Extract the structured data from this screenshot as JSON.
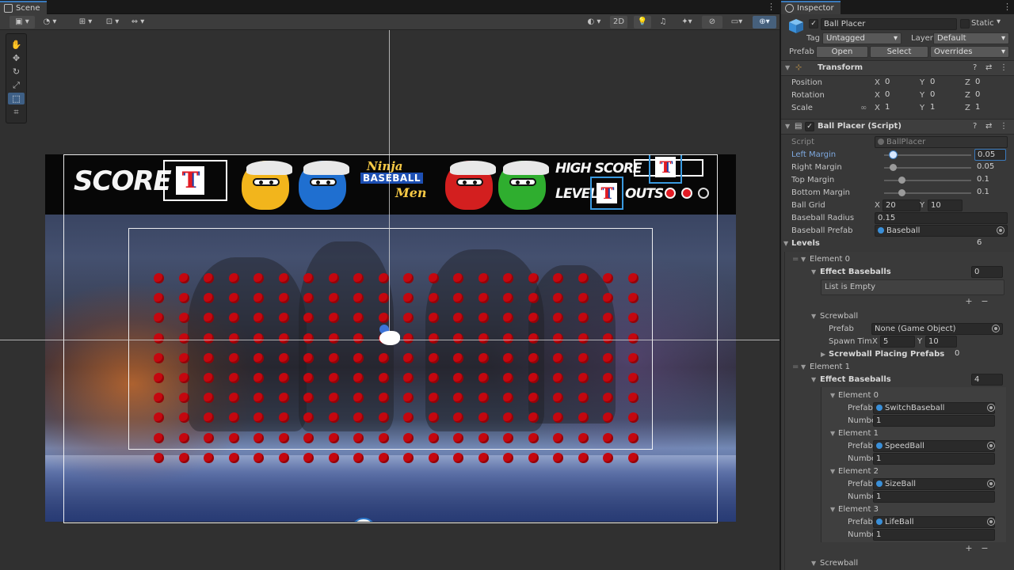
{
  "scene": {
    "tab_label": "Scene",
    "toolbar": {
      "two_d_label": "2D"
    }
  },
  "game": {
    "hud": {
      "score_label": "SCORE",
      "t_letter": "T",
      "high_score_label": "HIGH SCORE",
      "level_label": "LEVEL",
      "outs_label": "OUTS",
      "logo": {
        "line1": "Ninja",
        "line2": "BASEBALL",
        "line3": "Men"
      },
      "outs": [
        true,
        true,
        false
      ],
      "ninja_colors": [
        "#f2b51c",
        "#1f6fd0",
        "#d31f1f",
        "#2fae2f"
      ]
    },
    "ball_grid": {
      "columns": 20,
      "rows": 10,
      "ball_color": "#c4070f"
    }
  },
  "inspector": {
    "tab_label": "Inspector",
    "object_name": "Ball Placer",
    "static_label": "Static",
    "tag_label": "Tag",
    "tag_value": "Untagged",
    "layer_label": "Layer",
    "layer_value": "Default",
    "prefab_label": "Prefab",
    "prefab_open": "Open",
    "prefab_select": "Select",
    "prefab_overrides": "Overrides",
    "transform": {
      "title": "Transform",
      "position_label": "Position",
      "rotation_label": "Rotation",
      "scale_label": "Scale",
      "position": {
        "x": "0",
        "y": "0",
        "z": "0"
      },
      "rotation": {
        "x": "0",
        "y": "0",
        "z": "0"
      },
      "scale": {
        "x": "1",
        "y": "1",
        "z": "1"
      },
      "axis_x": "X",
      "axis_y": "Y",
      "axis_z": "Z"
    },
    "script_component": {
      "title": "Ball Placer (Script)",
      "script_label": "Script",
      "script_value": "BallPlacer",
      "left_margin_label": "Left Margin",
      "left_margin": "0.05",
      "left_margin_frac": 0.05,
      "right_margin_label": "Right Margin",
      "right_margin": "0.05",
      "right_margin_frac": 0.05,
      "top_margin_label": "Top Margin",
      "top_margin": "0.1",
      "top_margin_frac": 0.1,
      "bottom_margin_label": "Bottom Margin",
      "bottom_margin": "0.1",
      "bottom_margin_frac": 0.1,
      "ball_grid_label": "Ball Grid",
      "ball_grid_x": "20",
      "ball_grid_y": "10",
      "baseball_radius_label": "Baseball Radius",
      "baseball_radius": "0.15",
      "baseball_prefab_label": "Baseball Prefab",
      "baseball_prefab": "Baseball",
      "levels_label": "Levels",
      "levels_count": "6"
    },
    "levels": {
      "element0": {
        "label": "Element 0",
        "effect_baseballs_label": "Effect Baseballs",
        "effect_baseballs_count": "0",
        "list_empty": "List is Empty",
        "screwball_label": "Screwball",
        "prefab_label": "Prefab",
        "prefab_value": "None (Game Object)",
        "spawn_time_label": "Spawn Tim",
        "spawn_x": "5",
        "spawn_y": "10",
        "placing_prefabs_label": "Screwball Placing Prefabs",
        "placing_prefabs_count": "0"
      },
      "element1": {
        "label": "Element 1",
        "effect_baseballs_label": "Effect Baseballs",
        "effect_baseballs_count": "4",
        "prefab_label": "Prefab",
        "number_label": "Numbe",
        "items": [
          {
            "label": "Element 0",
            "prefab": "SwitchBaseball",
            "number": "1"
          },
          {
            "label": "Element 1",
            "prefab": "SpeedBall",
            "number": "1"
          },
          {
            "label": "Element 2",
            "prefab": "SizeBall",
            "number": "1"
          },
          {
            "label": "Element 3",
            "prefab": "LifeBall",
            "number": "1"
          }
        ],
        "screwball_label": "Screwball"
      }
    },
    "plus": "+",
    "minus": "−"
  }
}
